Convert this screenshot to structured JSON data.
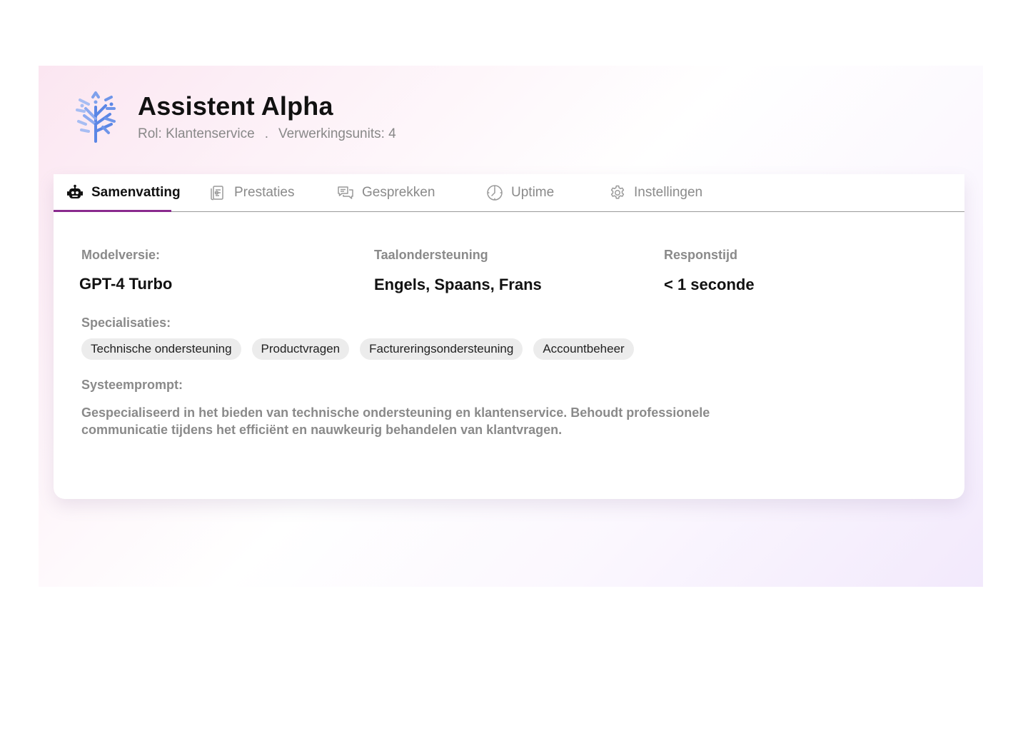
{
  "agent": {
    "name": "Assistent Alpha",
    "role": "Rol: Klantenservice",
    "separator": ".",
    "units": "Verwerkingsunits: 4"
  },
  "tabs": [
    {
      "label": "Samenvatting",
      "icon": "robot-icon",
      "active": true
    },
    {
      "label": "Prestaties",
      "icon": "document-icon",
      "active": false
    },
    {
      "label": "Gesprekken",
      "icon": "chat-icon",
      "active": false
    },
    {
      "label": "Uptime",
      "icon": "clock-icon",
      "active": false
    },
    {
      "label": "Instellingen",
      "icon": "gear-icon",
      "active": false
    }
  ],
  "summary": {
    "model_label": "Modelversie:",
    "model_value": "GPT-4 Turbo",
    "language_label": "Taalondersteuning",
    "language_value": "Engels, Spaans, Frans",
    "response_label": "Responstijd",
    "response_value": "< 1 seconde",
    "specializations_label": "Specialisaties:",
    "specializations": [
      "Technische ondersteuning",
      "Productvragen",
      "Factureringsondersteuning",
      "Accountbeheer"
    ],
    "prompt_label": "Systeemprompt:",
    "prompt_text": "Gespecialiseerd in het bieden van technische ondersteuning en klantenservice. Behoudt professionele communicatie tijdens het efficiënt en nauwkeurig behandelen van klantvragen."
  },
  "colors": {
    "accent": "#8a2a8e",
    "logo": "#5b86e5",
    "muted_text": "#8a8a8a",
    "chip_bg": "#ececec"
  }
}
